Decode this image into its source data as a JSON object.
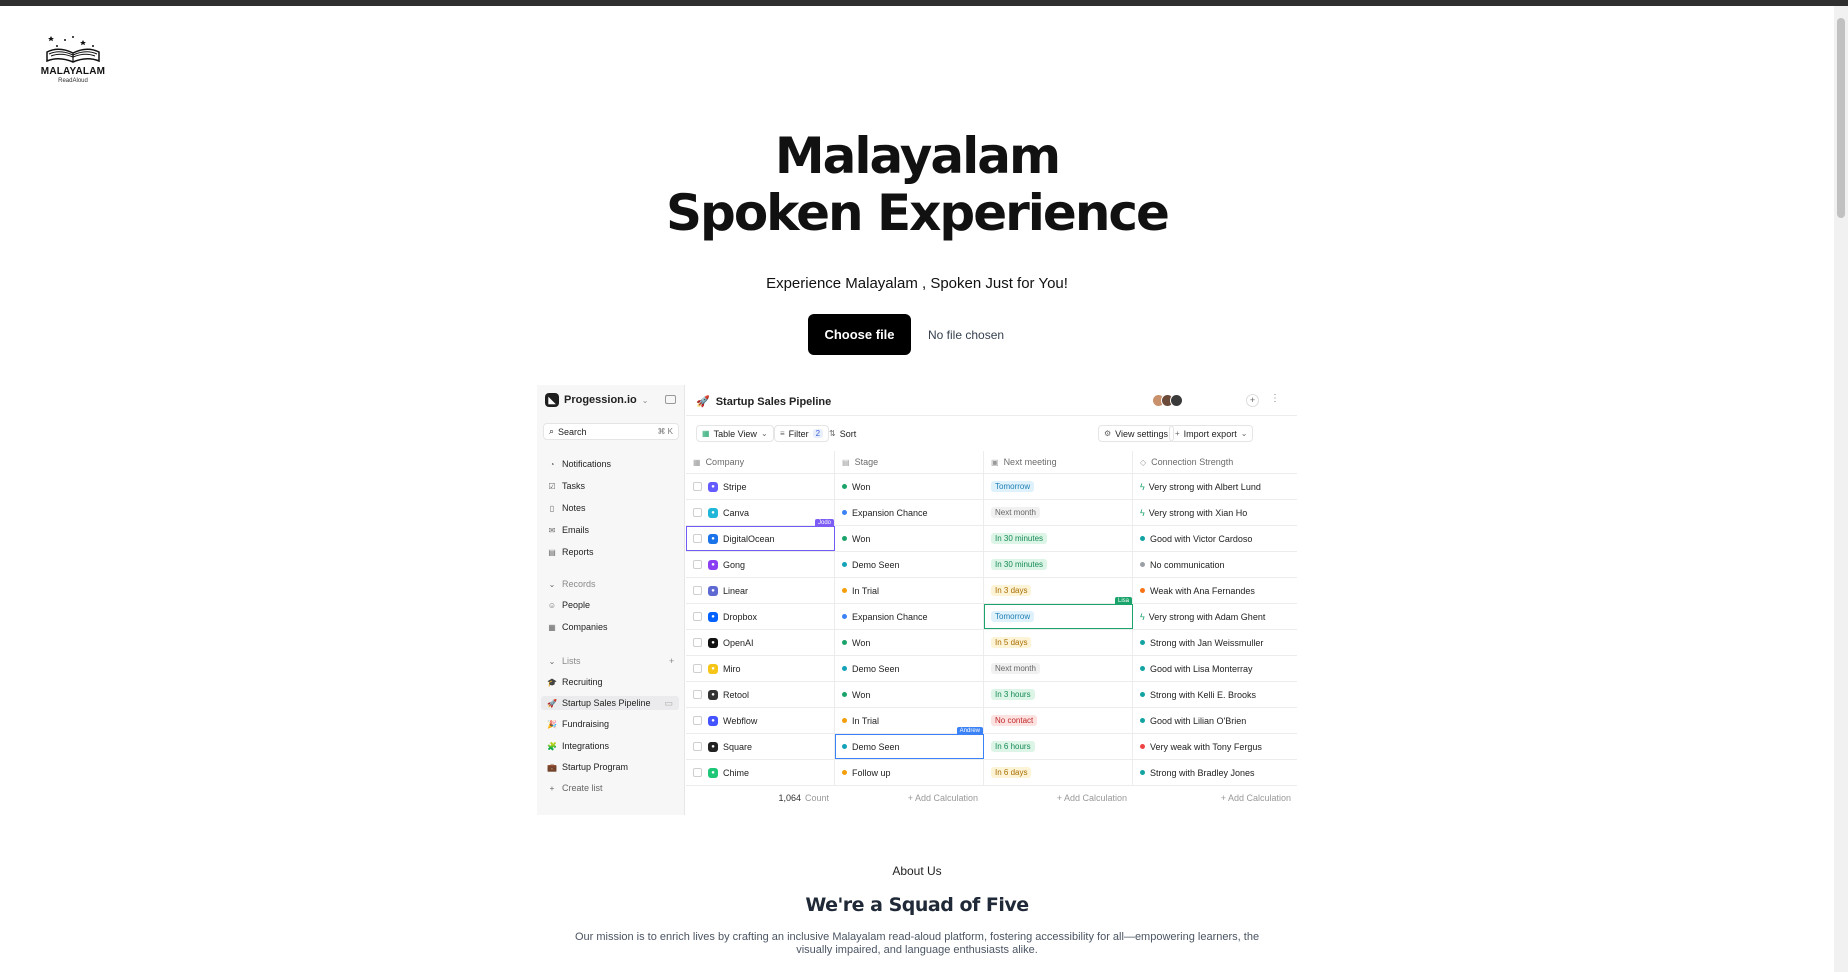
{
  "brand": {
    "name": "MALAYALAM",
    "sub": "ReadAloud",
    "logo_icon": "open-book-stars-icon"
  },
  "hero": {
    "title_line1": "Malayalam",
    "title_line2": "Spoken Experience",
    "tagline": "Experience Malayalam , Spoken Just for You!"
  },
  "uploader": {
    "button_label": "Choose file",
    "status": "No file chosen"
  },
  "app": {
    "workspace": "Progession.io",
    "search": {
      "label": "Search",
      "shortcut": "⌘ K"
    },
    "nav": [
      {
        "label": "Notifications",
        "icon": "bell-icon"
      },
      {
        "label": "Tasks",
        "icon": "check-square-icon"
      },
      {
        "label": "Notes",
        "icon": "note-icon"
      },
      {
        "label": "Emails",
        "icon": "mail-icon"
      },
      {
        "label": "Reports",
        "icon": "report-icon"
      }
    ],
    "records": {
      "heading": "Records",
      "items": [
        "People",
        "Companies"
      ]
    },
    "lists": {
      "heading": "Lists",
      "items": [
        "Recruiting",
        "Startup Sales Pipeline",
        "Fundraising",
        "Integrations",
        "Startup Program"
      ],
      "create": "Create list"
    },
    "page_title": "Startup Sales Pipeline",
    "toolbar": {
      "view": "Table View",
      "filter": "Filter",
      "filter_count": "2",
      "sort": "Sort",
      "settings": "View settings",
      "export": "Import export"
    },
    "columns": [
      "Company",
      "Stage",
      "Next meeting",
      "Connection Strength"
    ],
    "rows": [
      {
        "company": "Stripe",
        "logo_color": "#635bff",
        "stage": "Won",
        "stage_color": "#1aa36a",
        "meeting": "Tomorrow",
        "meeting_bg": "#dff1fb",
        "meeting_fg": "#1d7fb5",
        "strength": "Very strong with Albert Lund",
        "strength_color": "#1aa36a",
        "strength_icon": "bolt"
      },
      {
        "company": "Canva",
        "logo_color": "#1fb6d8",
        "stage": "Expansion Chance",
        "stage_color": "#3b82f6",
        "meeting": "Next month",
        "meeting_bg": "#f1f1f1",
        "meeting_fg": "#666666",
        "strength": "Very strong with Xian Ho",
        "strength_color": "#1aa36a",
        "strength_icon": "bolt"
      },
      {
        "company": "DigitalOcean",
        "logo_color": "#1a73e8",
        "stage": "Won",
        "stage_color": "#1aa36a",
        "meeting": "In 30 minutes",
        "meeting_bg": "#dcf5e7",
        "meeting_fg": "#178a55",
        "strength": "Good with Victor Cardoso",
        "strength_color": "#14a3a3",
        "strength_icon": "dot",
        "tag": "Jodo",
        "tag_color": "#7c5cf4"
      },
      {
        "company": "Gong",
        "logo_color": "#8b3ff2",
        "stage": "Demo Seen",
        "stage_color": "#14a3b8",
        "meeting": "In 30 minutes",
        "meeting_bg": "#dcf5e7",
        "meeting_fg": "#178a55",
        "strength": "No communication",
        "strength_color": "#9aa0a6",
        "strength_icon": "dot"
      },
      {
        "company": "Linear",
        "logo_color": "#5e6ad2",
        "stage": "In Trial",
        "stage_color": "#f59e0b",
        "meeting": "In 3 days",
        "meeting_bg": "#fdf3d6",
        "meeting_fg": "#a76d00",
        "strength": "Weak with Ana Fernandes",
        "strength_color": "#f97316",
        "strength_icon": "dot"
      },
      {
        "company": "Dropbox",
        "logo_color": "#0061fe",
        "stage": "Expansion Chance",
        "stage_color": "#3b82f6",
        "meeting": "Tomorrow",
        "meeting_bg": "#dff1fb",
        "meeting_fg": "#1d7fb5",
        "strength": "Very strong with Adam Ghent",
        "strength_color": "#1aa36a",
        "strength_icon": "bolt",
        "tag": "Lisa",
        "tag_color": "#1aa36a"
      },
      {
        "company": "OpenAI",
        "logo_color": "#111111",
        "stage": "Won",
        "stage_color": "#1aa36a",
        "meeting": "In 5 days",
        "meeting_bg": "#fdf3d6",
        "meeting_fg": "#a76d00",
        "strength": "Strong with Jan Weissmuller",
        "strength_color": "#14a3a3",
        "strength_icon": "dot"
      },
      {
        "company": "Miro",
        "logo_color": "#f5c518",
        "stage": "Demo Seen",
        "stage_color": "#14a3b8",
        "meeting": "Next month",
        "meeting_bg": "#f1f1f1",
        "meeting_fg": "#666666",
        "strength": "Good with Lisa Monterray",
        "strength_color": "#14a3a3",
        "strength_icon": "dot"
      },
      {
        "company": "Retool",
        "logo_color": "#333333",
        "stage": "Won",
        "stage_color": "#1aa36a",
        "meeting": "In 3 hours",
        "meeting_bg": "#dcf5e7",
        "meeting_fg": "#178a55",
        "strength": "Strong with Kelli E. Brooks",
        "strength_color": "#14a3a3",
        "strength_icon": "dot"
      },
      {
        "company": "Webflow",
        "logo_color": "#4353ff",
        "stage": "In Trial",
        "stage_color": "#f59e0b",
        "meeting": "No contact",
        "meeting_bg": "#fde2e2",
        "meeting_fg": "#c02626",
        "strength": "Good with Lilian O'Brien",
        "strength_color": "#14a3a3",
        "strength_icon": "dot"
      },
      {
        "company": "Square",
        "logo_color": "#222222",
        "stage": "Demo Seen",
        "stage_color": "#14a3b8",
        "meeting": "In 6 hours",
        "meeting_bg": "#dcf5e7",
        "meeting_fg": "#178a55",
        "strength": "Very weak with Tony Fergus",
        "strength_color": "#ef4444",
        "strength_icon": "dot",
        "tag": "Andrew",
        "tag_color": "#3b82f6"
      },
      {
        "company": "Chime",
        "logo_color": "#1ec677",
        "stage": "Follow up",
        "stage_color": "#f59e0b",
        "meeting": "In 6 days",
        "meeting_bg": "#fdf3d6",
        "meeting_fg": "#a76d00",
        "strength": "Strong with Bradley Jones",
        "strength_color": "#14a3a3",
        "strength_icon": "dot"
      }
    ],
    "footer": {
      "count_value": "1,064",
      "count_label": "Count",
      "add_calc": "+ Add Calculation"
    }
  },
  "about": {
    "kicker": "About Us",
    "title": "We're a Squad of Five",
    "text": "Our mission is to enrich lives by crafting an inclusive Malayalam read-aloud platform, fostering accessibility for all—empowering learners, the visually impaired, and language enthusiasts alike."
  }
}
